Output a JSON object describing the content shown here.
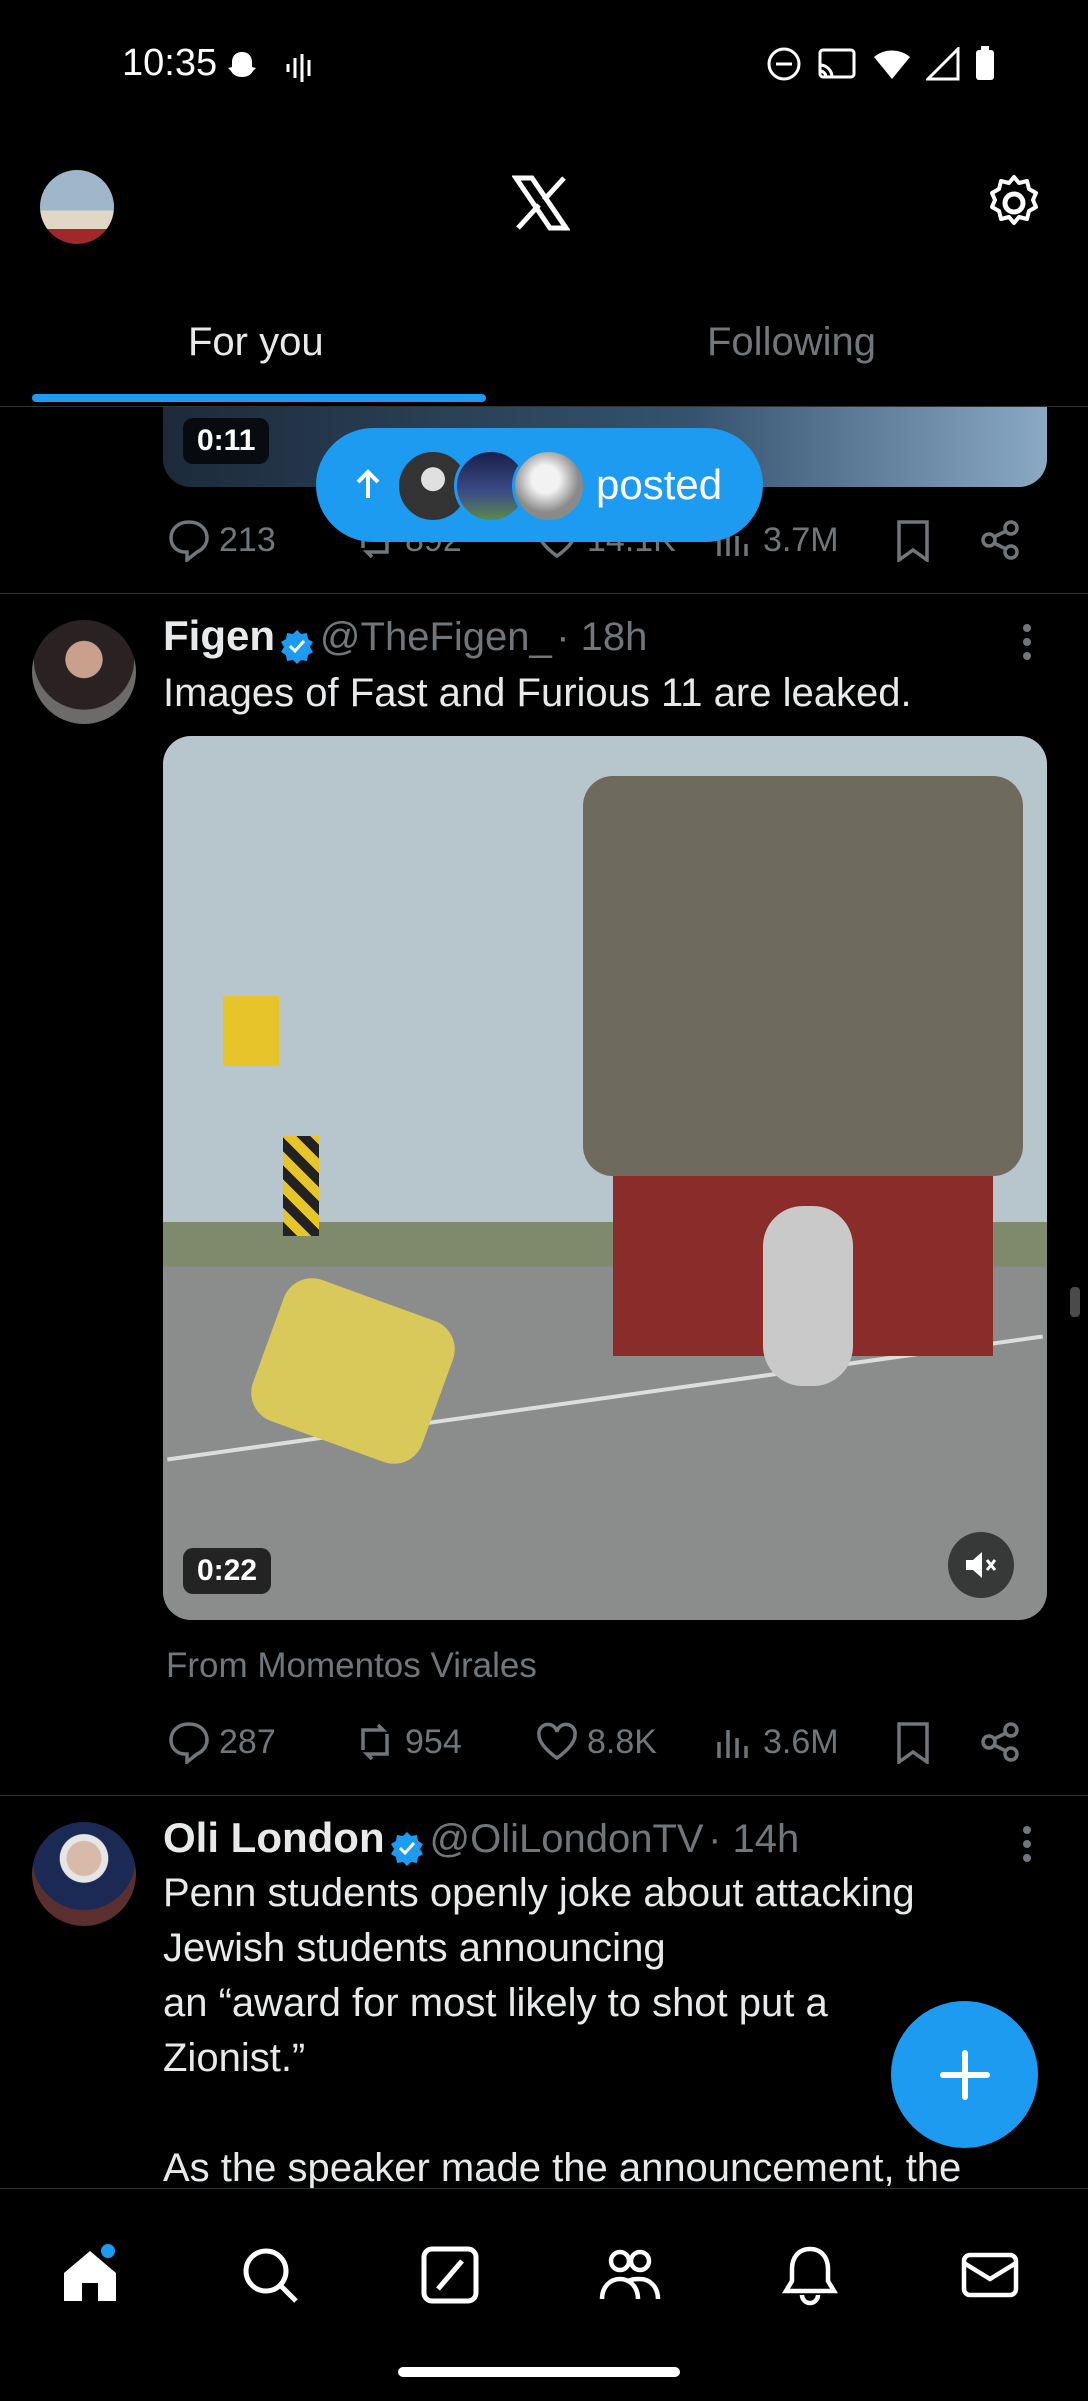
{
  "status": {
    "time": "10:35"
  },
  "header": {
    "logo": "X"
  },
  "tabs": [
    {
      "label": "For you",
      "active": true
    },
    {
      "label": "Following",
      "active": false
    }
  ],
  "pill": {
    "label": "posted"
  },
  "prev_tweet": {
    "video_time": "0:11",
    "replies": "213",
    "reposts": "892",
    "likes": "14.1K",
    "views": "3.7M"
  },
  "tweet1": {
    "name": "Figen",
    "handle": "@TheFigen_",
    "time": "· 18h",
    "text": "Images of Fast and Furious 11 are leaked.",
    "video_time": "0:22",
    "source": "From Momentos Virales",
    "replies": "287",
    "reposts": "954",
    "likes": "8.8K",
    "views": "3.6M"
  },
  "tweet2": {
    "name": "Oli London",
    "handle": "@OliLondonTV",
    "time": "· 14h",
    "lines": [
      "Penn students openly joke about attacking",
      "Jewish students announcing",
      "an “award for most likely to shot put a",
      "Zionist.”",
      "",
      "As the speaker made the announcement, the"
    ]
  },
  "colors": {
    "accent": "#1d9bf0",
    "background": "#000000",
    "muted": "#71767b"
  },
  "nav": [
    "home-icon",
    "search-icon",
    "grok-icon",
    "communities-icon",
    "notifications-icon",
    "messages-icon"
  ]
}
